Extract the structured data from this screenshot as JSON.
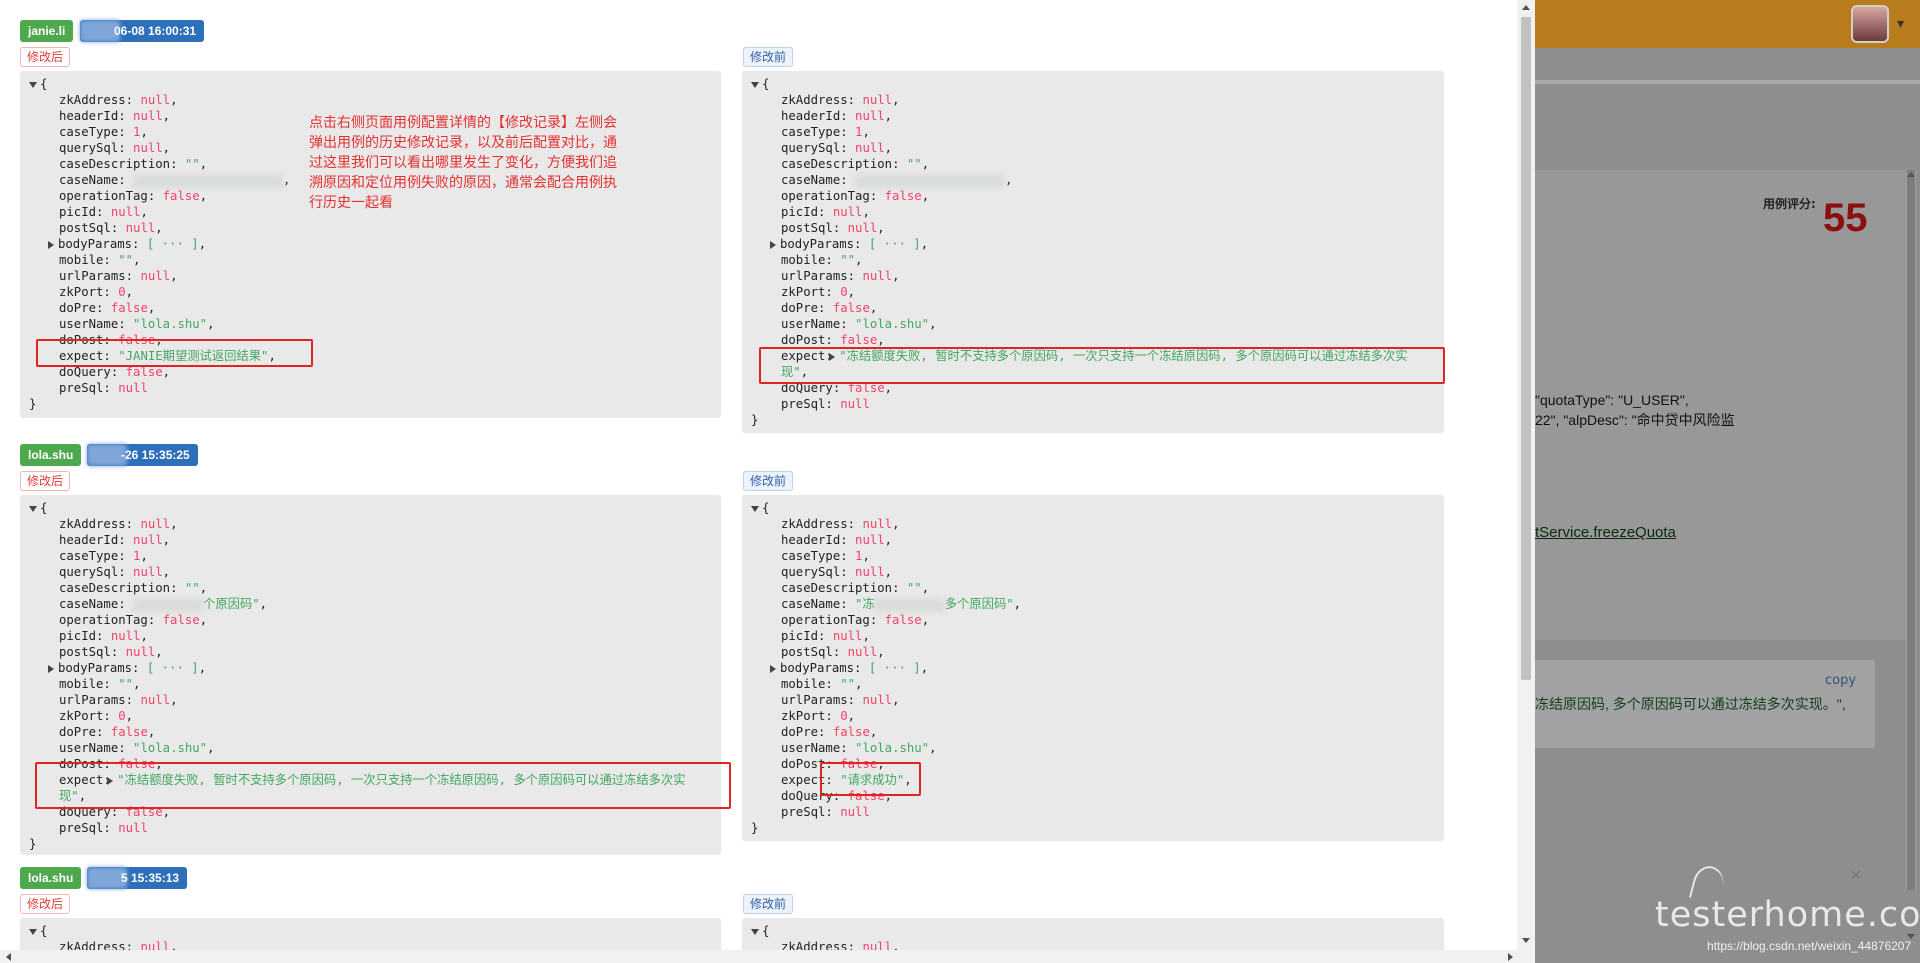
{
  "annotation": "点击右侧页面用例配置详情的【修改记录】左侧会弹出用例的历史修改记录，以及前后配置对比，通过这里我们可以看出哪里发生了变化，方便我们追溯原因和定位用例失败的原因，通常会配合用例执行历史一起看",
  "labels": {
    "after": "修改后",
    "before": "修改前"
  },
  "records": [
    {
      "user": "janie.li",
      "time": "06-08 16:00:31"
    },
    {
      "user": "lola.shu",
      "time": "-26 15:35:25"
    },
    {
      "user": "lola.shu",
      "time": "5 15:35:13"
    }
  ],
  "json_keys": {
    "zkAddress": "zkAddress",
    "headerId": "headerId",
    "caseType": "caseType",
    "querySql": "querySql",
    "caseDescription": "caseDescription",
    "caseName": "caseName",
    "operationTag": "operationTag",
    "picId": "picId",
    "postSql": "postSql",
    "bodyParams": "bodyParams",
    "mobile": "mobile",
    "urlParams": "urlParams",
    "zkPort": "zkPort",
    "doPre": "doPre",
    "userName": "userName",
    "doPost": "doPost",
    "expect": "expect",
    "doQuery": "doQuery",
    "preSql": "preSql"
  },
  "json_values": {
    "null": "null",
    "false": "false",
    "one": "1",
    "zero": "0",
    "empty": "\"\"",
    "lola": "\"lola.shu\"",
    "collapsed": "[ ··· ]",
    "brace_open": "{",
    "brace_close": "}",
    "caseName_r2_after": "个原因码\"",
    "caseName_r2_before_a": "\"冻",
    "caseName_r2_before_b": "多个原因码\"",
    "expect_janie": "\"JANIE期望测试返回结果\"",
    "expect_freeze": "\"冻结额度失败, 暂时不支持多个原因码, 一次只支持一个冻结原因码, 多个原因码可以通过冻结多次实现\"",
    "expect_ok": "\"请求成功\""
  },
  "background": {
    "score_label": "用例评分:",
    "score": "55",
    "line1": "\"quotaType\": \"U_USER\",",
    "line2": "22\", \"alpDesc\": \"命中贷中风险监",
    "link": "tService.freezeQuota",
    "copy": "copy",
    "code_line": "冻结原因码, 多个原因码可以通过冻结多次实现。\",",
    "watermark": "testerhome.com",
    "url": "https://blog.csdn.net/weixin_44876207"
  },
  "colors": {
    "user_badge": "#4ea84e",
    "time_badge": "#2e6fba",
    "highlight": "#e02525",
    "annotation": "#e53030",
    "string": "#42a760",
    "literal": "#f4426c"
  }
}
